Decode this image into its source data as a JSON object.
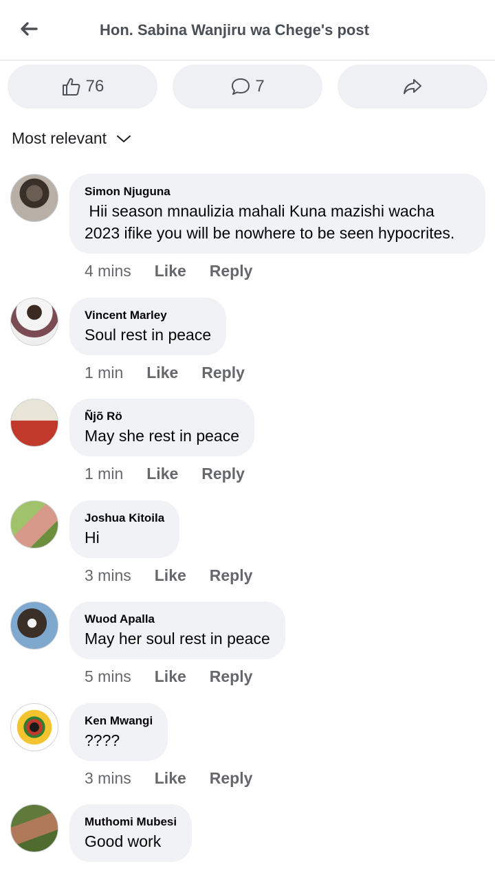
{
  "header": {
    "title": "Hon. Sabina Wanjiru wa Chege's post",
    "back_icon": "arrow-left-icon"
  },
  "actions": {
    "likes": "76",
    "comments": "7",
    "like_icon": "thumbs-up-icon",
    "comment_icon": "speech-bubble-icon",
    "share_icon": "share-arrow-icon"
  },
  "sort": {
    "label": "Most relevant",
    "icon": "chevron-down-icon"
  },
  "comments": [
    {
      "author": "Simon Njuguna",
      "text": " Hii season mnaulizia mahali Kuna mazishi wacha 2023 ifike you will be nowhere to be seen hypocrites.",
      "time": "4 mins",
      "like": "Like",
      "reply": "Reply"
    },
    {
      "author": "Vincent Marley",
      "text": "Soul rest in peace",
      "time": "1 min",
      "like": "Like",
      "reply": "Reply"
    },
    {
      "author": "Ñjõ Rö",
      "text": "May she rest in peace",
      "time": "1 min",
      "like": "Like",
      "reply": "Reply"
    },
    {
      "author": "Joshua Kitoila",
      "text": "Hi",
      "time": "3 mins",
      "like": "Like",
      "reply": "Reply"
    },
    {
      "author": "Wuod Apalla",
      "text": "May her soul rest in peace",
      "time": "5 mins",
      "like": "Like",
      "reply": "Reply"
    },
    {
      "author": "Ken Mwangi",
      "text": "????",
      "time": "3 mins",
      "like": "Like",
      "reply": "Reply"
    },
    {
      "author": "Muthomi Mubesi",
      "text": "Good work",
      "time": "",
      "like": "",
      "reply": ""
    }
  ]
}
